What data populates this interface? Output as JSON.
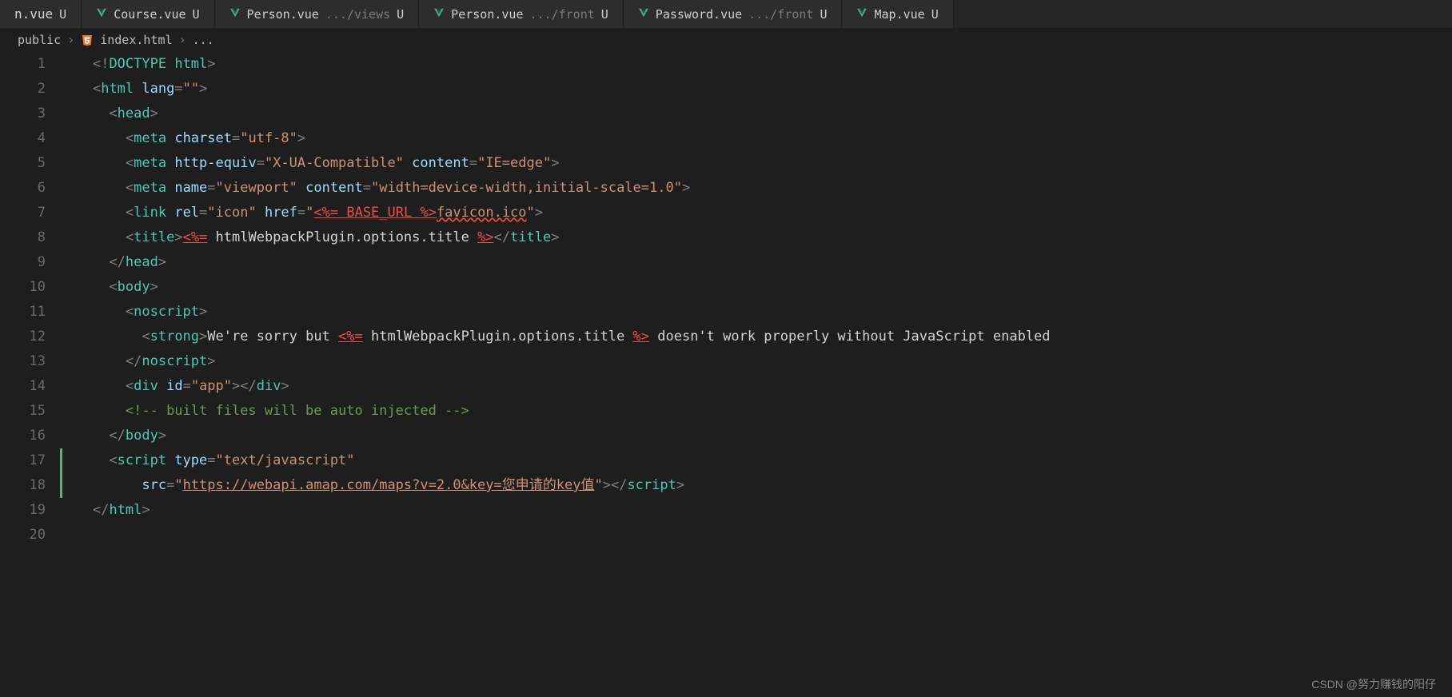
{
  "tabs": [
    {
      "name": "n.vue",
      "sub": "",
      "mod": "U",
      "partial": true
    },
    {
      "name": "Course.vue",
      "sub": "",
      "mod": "U"
    },
    {
      "name": "Person.vue",
      "sub": ".../views",
      "mod": "U"
    },
    {
      "name": "Person.vue",
      "sub": ".../front",
      "mod": "U"
    },
    {
      "name": "Password.vue",
      "sub": ".../front",
      "mod": "U"
    },
    {
      "name": "Map.vue",
      "sub": "",
      "mod": "U",
      "partial_right": true
    }
  ],
  "breadcrumb": {
    "seg1": "public",
    "seg2": "index.html",
    "seg3": "..."
  },
  "code": {
    "lines": 20,
    "l1": {
      "a": "<!",
      "b": "DOCTYPE",
      "c": " html",
      "d": ">"
    },
    "l2": {
      "a": "<",
      "b": "html",
      "c": " lang",
      "d": "=",
      "e": "\"\"",
      "f": ">"
    },
    "l3": {
      "a": "<",
      "b": "head",
      "c": ">"
    },
    "l4": {
      "a": "<",
      "b": "meta",
      "c": " charset",
      "d": "=",
      "e": "\"utf-8\"",
      "f": ">"
    },
    "l5": {
      "a": "<",
      "b": "meta",
      "c": " http-equiv",
      "d": "=",
      "e": "\"X-UA-Compatible\"",
      "f": " content",
      "g": "=",
      "h": "\"IE=edge\"",
      "i": ">"
    },
    "l6": {
      "a": "<",
      "b": "meta",
      "c": " name",
      "d": "=",
      "e": "\"viewport\"",
      "f": " content",
      "g": "=",
      "h": "\"width=device-width,initial-scale=1.0\"",
      "i": ">"
    },
    "l7": {
      "a": "<",
      "b": "link",
      "c": " rel",
      "d": "=",
      "e": "\"icon\"",
      "f": " href",
      "g": "=",
      "h": "\"",
      "i": "<%= BASE_URL %>",
      "j": "favicon.ico",
      "k": "\"",
      "l": ">"
    },
    "l8": {
      "a": "<",
      "b": "title",
      "c": ">",
      "d": "<%=",
      "e": " htmlWebpackPlugin.options.title ",
      "f": "%>",
      "g": "</",
      "h": "title",
      "i": ">"
    },
    "l9": {
      "a": "</",
      "b": "head",
      "c": ">"
    },
    "l10": {
      "a": "<",
      "b": "body",
      "c": ">"
    },
    "l11": {
      "a": "<",
      "b": "noscript",
      "c": ">"
    },
    "l12": {
      "a": "<",
      "b": "strong",
      "c": ">",
      "d": "We're sorry but ",
      "e": "<%=",
      "f": " htmlWebpackPlugin.options.title ",
      "g": "%>",
      "h": " doesn't work properly without JavaScript enabled"
    },
    "l13": {
      "a": "</",
      "b": "noscript",
      "c": ">"
    },
    "l14": {
      "a": "<",
      "b": "div",
      "c": " id",
      "d": "=",
      "e": "\"app\"",
      "f": ">",
      "g": "</",
      "h": "div",
      "i": ">"
    },
    "l15": {
      "a": "<!-- built files will be auto injected -->"
    },
    "l16": {
      "a": "</",
      "b": "body",
      "c": ">"
    },
    "l17": {
      "a": "<",
      "b": "script",
      "c": " type",
      "d": "=",
      "e": "\"text/javascript\""
    },
    "l18": {
      "a": "src",
      "b": "=",
      "c": "\"",
      "d": "https://webapi.amap.com/maps?v=2.0&key=您申请的key值",
      "e": "\"",
      "f": ">",
      "g": "</",
      "h": "script",
      "i": ">"
    },
    "l19": {
      "a": "</",
      "b": "html",
      "c": ">"
    }
  },
  "indents": {
    "l1": "    ",
    "l2": "    ",
    "l3": "      ",
    "l4": "        ",
    "l5": "        ",
    "l6": "        ",
    "l7": "        ",
    "l8": "        ",
    "l9": "      ",
    "l10": "      ",
    "l11": "        ",
    "l12": "          ",
    "l13": "        ",
    "l14": "        ",
    "l15": "        ",
    "l16": "      ",
    "l17": "      ",
    "l18": "          ",
    "l19": "    "
  },
  "watermark": "CSDN @努力赚钱的阳仔"
}
